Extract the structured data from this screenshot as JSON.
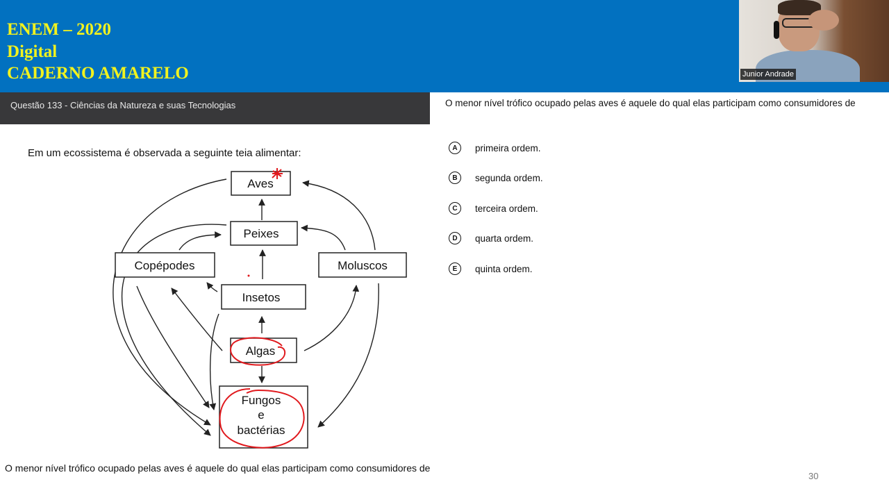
{
  "header": {
    "lines": [
      "ENEM – 2020",
      "Digital",
      "CADERNO AMARELO"
    ],
    "background_color": "#0271c0",
    "title_color": "#f2f21e"
  },
  "webcam": {
    "participant_name": "Junior Andrade"
  },
  "question": {
    "header": "Questão 133 - Ciências da Natureza e suas Tecnologias",
    "intro": "Em um ecossistema é observada a seguinte teia alimentar:",
    "stem": "O menor nível trófico ocupado pelas aves é aquele do qual elas participam como consumidores de",
    "options": [
      {
        "letter": "A",
        "text": "primeira ordem."
      },
      {
        "letter": "B",
        "text": "segunda ordem."
      },
      {
        "letter": "C",
        "text": "terceira ordem."
      },
      {
        "letter": "D",
        "text": "quarta ordem."
      },
      {
        "letter": "E",
        "text": "quinta ordem."
      }
    ]
  },
  "food_web": {
    "nodes": {
      "aves": "Aves",
      "peixes": "Peixes",
      "copepodes": "Copépodes",
      "moluscos": "Moluscos",
      "insetos": "Insetos",
      "algas": "Algas",
      "fungos": [
        "Fungos",
        "e",
        "bactérias"
      ]
    },
    "annotation_color": "#e0191d"
  },
  "bottom_text": "O menor nível trófico ocupado pelas aves é aquele do qual elas participam como consumidores de",
  "page_number": "30"
}
